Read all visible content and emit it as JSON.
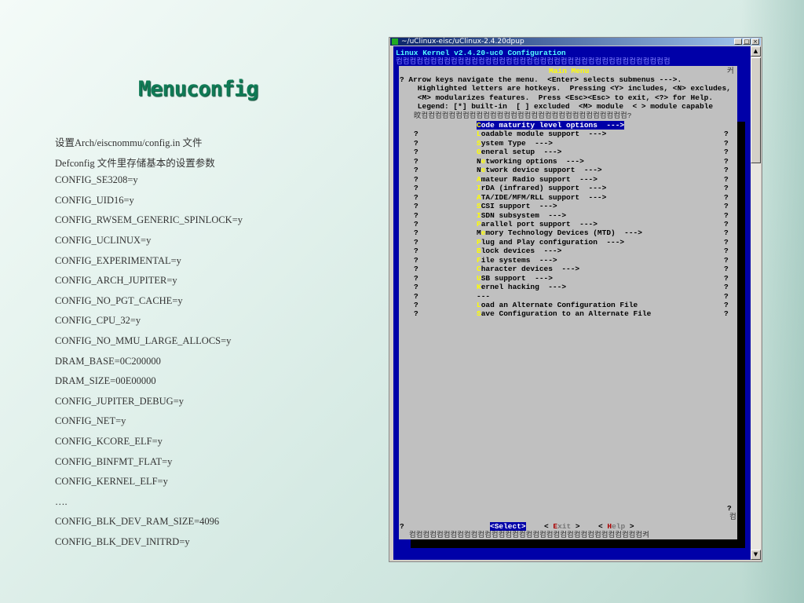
{
  "slide": {
    "title": "Menuconfig",
    "lines": [
      "设置Arch/eiscnommu/config.in 文件",
      "Defconfig 文件里存储基本的设置参数",
      "CONFIG_SE3208=y",
      "CONFIG_UID16=y",
      "CONFIG_RWSEM_GENERIC_SPINLOCK=y",
      "CONFIG_UCLINUX=y",
      "CONFIG_EXPERIMENTAL=y",
      "CONFIG_ARCH_JUPITER=y",
      "CONFIG_NO_PGT_CACHE=y",
      "CONFIG_CPU_32=y",
      "CONFIG_NO_MMU_LARGE_ALLOCS=y",
      "DRAM_BASE=0C200000",
      "DRAM_SIZE=00E00000",
      "CONFIG_JUPITER_DEBUG=y",
      "CONFIG_NET=y",
      "CONFIG_KCORE_ELF=y",
      "CONFIG_BINFMT_FLAT=y",
      "CONFIG_KERNEL_ELF=y",
      "….",
      "CONFIG_BLK_DEV_RAM_SIZE=4096",
      "CONFIG_BLK_DEV_INITRD=y"
    ]
  },
  "window": {
    "title": "~/uClinux-eisc/uClinux-2.4.20dpup",
    "min": "_",
    "max": "□",
    "close": "×"
  },
  "terminal": {
    "header": "Linux Kernel v2.4.20-uc0 Configuration",
    "border_glyphs": "컴컴컴컴컴컴컴컴컴컴컴컴컴컴컴컴컴컴컴컴컴컴컴컴컴컴컴컴컴컴컴컴컴컴컴컴컴컴컴컴",
    "menu_title": "Main Menu",
    "corner": "커",
    "help": [
      "? Arrow keys navigate the menu.  <Enter> selects submenus --->.",
      "    Highlighted letters are hotkeys.  Pressing <Y> includes, <N> excludes,",
      "    <M> modularizes features.  Press <Esc><Esc> to exit, <?> for Help.",
      "    Legend: [*] built-in  [ ] excluded  <M> module  < > module capable"
    ],
    "inner_border": "旼컴컴컴컴컴컴컴컴컴컴컴컴컴컴컴컴컴컴컴컴컴컴컴컴컴컴컴컴컴컴?",
    "items": [
      {
        "hot": "C",
        "rest": "ode maturity level options  --->",
        "selected": true
      },
      {
        "hot": "L",
        "rest": "oadable module support  --->"
      },
      {
        "hot": "S",
        "rest": "ystem Type  --->"
      },
      {
        "hot": "G",
        "rest": "eneral setup  --->"
      },
      {
        "pre": "N",
        "hot": "e",
        "rest": "tworking options  --->"
      },
      {
        "pre": "N",
        "hot": "e",
        "rest": "twork device support  --->"
      },
      {
        "hot": "A",
        "rest": "mateur Radio support  --->"
      },
      {
        "hot": "I",
        "rest": "rDA (infrared) support  --->"
      },
      {
        "hot": "A",
        "rest": "TA/IDE/MFM/RLL support  --->"
      },
      {
        "hot": "S",
        "rest": "CSI support  --->"
      },
      {
        "hot": "I",
        "rest": "SDN subsystem  --->"
      },
      {
        "hot": "P",
        "rest": "arallel port support  --->"
      },
      {
        "pre": "M",
        "hot": "e",
        "rest": "mory Technology Devices (MTD)  --->"
      },
      {
        "hot": "P",
        "rest": "lug and Play configuration  --->"
      },
      {
        "hot": "B",
        "rest": "lock devices  --->"
      },
      {
        "hot": "F",
        "rest": "ile systems  --->"
      },
      {
        "hot": "C",
        "rest": "haracter devices  --->"
      },
      {
        "hot": "U",
        "rest": "SB support  --->"
      },
      {
        "hot": "K",
        "rest": "ernel hacking  --->"
      },
      {
        "hot": "",
        "rest": "---"
      },
      {
        "hot": "L",
        "rest": "oad an Alternate Configuration File"
      },
      {
        "hot": "S",
        "rest": "ave Configuration to an Alternate File"
      }
    ],
    "q": "?",
    "bottom_corner": "컴",
    "buttons": {
      "select": "<Select>",
      "exit_l": "< ",
      "exit_hot": "E",
      "exit_rest": "xit",
      "exit_r": " >",
      "help_l": "< ",
      "help_hot": "H",
      "help_rest": "elp",
      "help_r": " >"
    },
    "bottom_border": "컴컴컴컴컴컴컴컴컴컴컴컴컴컴컴컴컴컴컴컴컴컴컴컴컴컴컴컴컴컴컴컴컴컴켜"
  }
}
